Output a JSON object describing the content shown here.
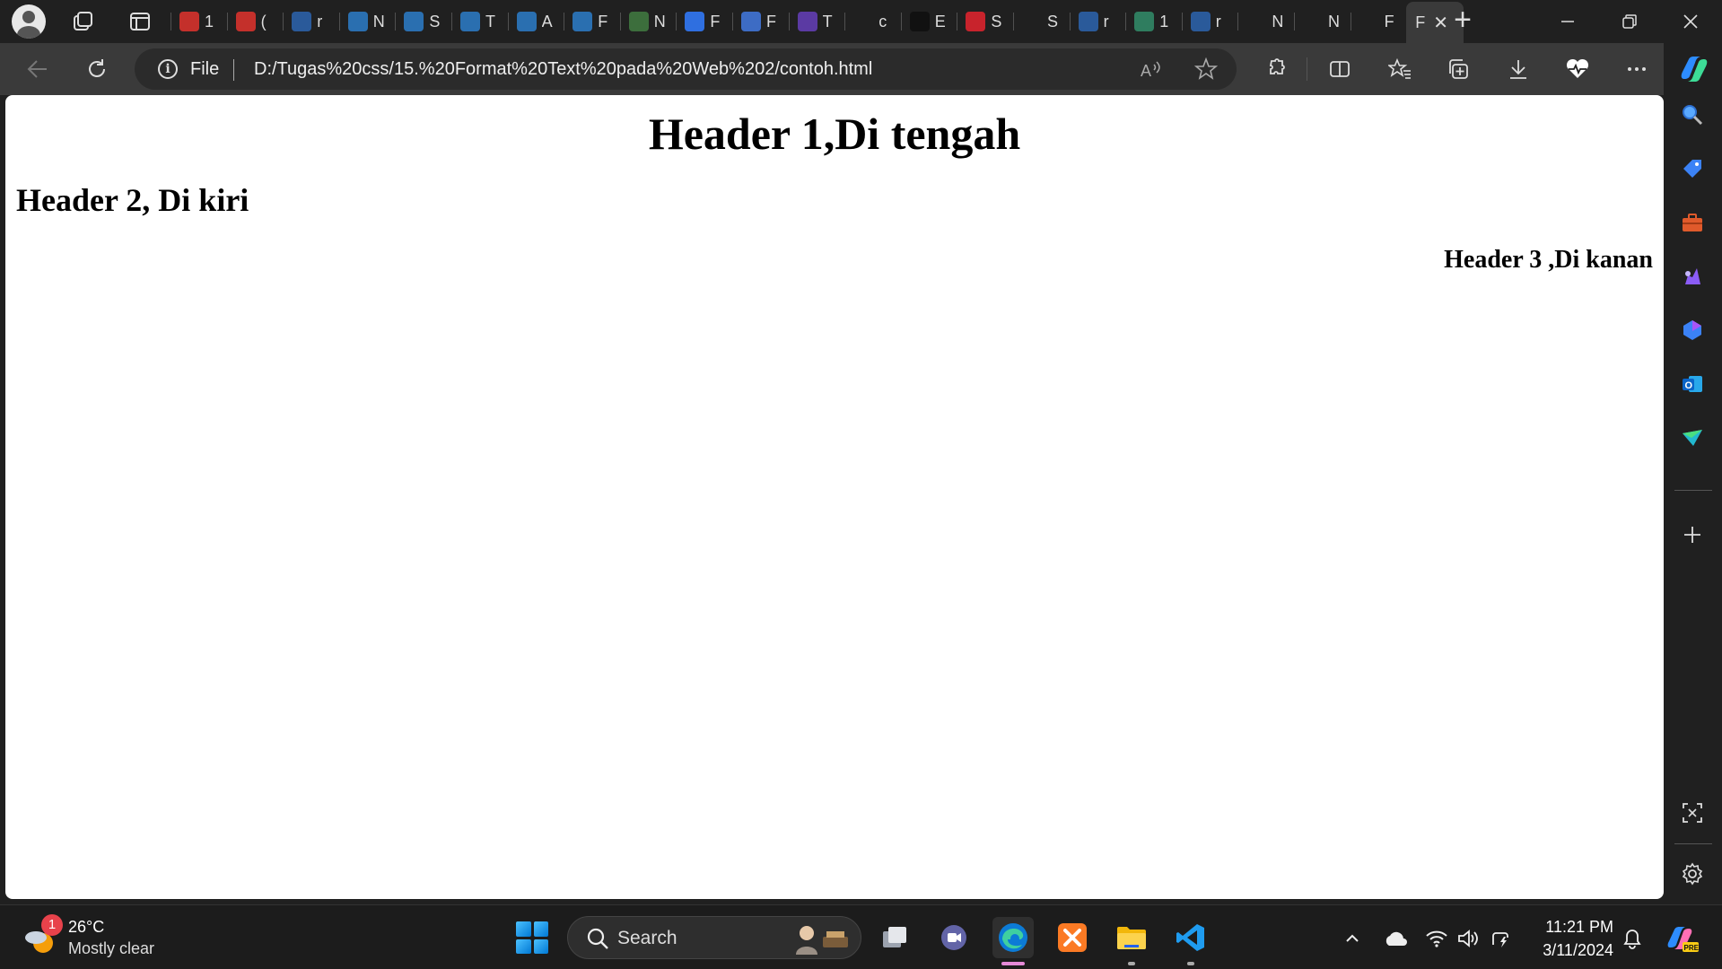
{
  "tabstrip": {
    "tabs": [
      {
        "icon": "youtube-icon",
        "ch": "1",
        "color": "#c4302b"
      },
      {
        "icon": "youtube-icon",
        "ch": "(",
        "color": "#c4302b"
      },
      {
        "icon": "search-icon",
        "ch": "r",
        "color": "#2a5a9a"
      },
      {
        "icon": "react-icon",
        "ch": "N",
        "color": "#2a6fb0"
      },
      {
        "icon": "react-icon",
        "ch": "S",
        "color": "#2a6fb0"
      },
      {
        "icon": "react-icon",
        "ch": "T",
        "color": "#2a6fb0"
      },
      {
        "icon": "react-icon",
        "ch": "A",
        "color": "#2a6fb0"
      },
      {
        "icon": "react-icon",
        "ch": "F",
        "color": "#2a6fb0"
      },
      {
        "icon": "node-icon",
        "ch": "N",
        "color": "#3c6e3c"
      },
      {
        "icon": "contacts-icon",
        "ch": "F",
        "color": "#2f6fe0"
      },
      {
        "icon": "docs-icon",
        "ch": "F",
        "color": "#3d6cc4"
      },
      {
        "icon": "list-icon",
        "ch": "T",
        "color": "#5b3aa3"
      },
      {
        "icon": "page-icon",
        "ch": "c",
        "color": "#202020"
      },
      {
        "icon": "dark-site-icon",
        "ch": "E",
        "color": "#111111"
      },
      {
        "icon": "pinterest-icon",
        "ch": "S",
        "color": "#c8232c"
      },
      {
        "icon": "page-icon",
        "ch": "S",
        "color": "#202020"
      },
      {
        "icon": "search-icon",
        "ch": "r",
        "color": "#2a5a9a"
      },
      {
        "icon": "d-app-icon",
        "ch": "1",
        "color": "#2f7d5f"
      },
      {
        "icon": "search-icon",
        "ch": "r",
        "color": "#2a5a9a"
      },
      {
        "icon": "page-icon",
        "ch": "N",
        "color": "#202020"
      },
      {
        "icon": "page-icon",
        "ch": "N",
        "color": "#202020"
      },
      {
        "icon": "page-icon",
        "ch": "F",
        "color": "#202020"
      }
    ],
    "active_tab": {
      "ch": "F",
      "close": "✕"
    },
    "new_tab": "+"
  },
  "toolbar": {
    "address_scheme": "File",
    "url": "D:/Tugas%20css/15.%20Format%20Text%20pada%20Web%202/contoh.html"
  },
  "page": {
    "h1": "Header 1,Di tengah",
    "h2": "Header 2, Di kiri",
    "h3": "Header 3 ,Di kanan"
  },
  "taskbar": {
    "weather_temp": "26°C",
    "weather_desc": "Mostly clear",
    "weather_badge": "1",
    "search_label": "Search",
    "time": "11:21 PM",
    "date": "3/11/2024"
  }
}
